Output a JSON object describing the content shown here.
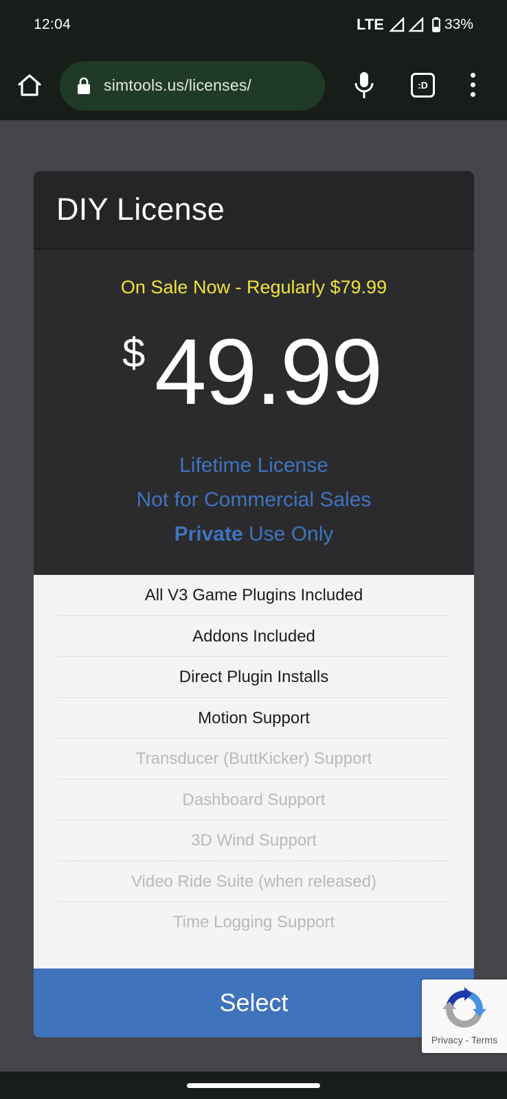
{
  "status_bar": {
    "time": "12:04",
    "network": "LTE",
    "battery": "33%"
  },
  "browser": {
    "url": "simtools.us/licenses/",
    "tab_label": ":D",
    "icons": [
      "home-icon",
      "lock-icon",
      "mic-icon",
      "tab-switcher-icon",
      "more-vert-icon"
    ]
  },
  "license": {
    "title": "DIY License",
    "sale_text": "On Sale Now - Regularly $79.99",
    "currency": "$",
    "price": "49.99",
    "terms": {
      "lifetime": "Lifetime License",
      "commercial": "Not for Commercial Sales",
      "private_bold": "Private",
      "private_rest": " Use Only"
    },
    "features": [
      {
        "label": "All V3 Game Plugins Included",
        "included": true
      },
      {
        "label": "Addons Included",
        "included": true
      },
      {
        "label": "Direct Plugin Installs",
        "included": true
      },
      {
        "label": "Motion Support",
        "included": true
      },
      {
        "label": "Transducer (ButtKicker) Support",
        "included": false
      },
      {
        "label": "Dashboard Support",
        "included": false
      },
      {
        "label": "3D Wind Support",
        "included": false
      },
      {
        "label": "Video Ride Suite (when released)",
        "included": false
      },
      {
        "label": "Time Logging Support",
        "included": false
      }
    ],
    "select_label": "Select"
  },
  "recaptcha": {
    "privacy": "Privacy",
    "separator": " - ",
    "terms": "Terms"
  },
  "colors": {
    "sale": "#efe33a",
    "terms_blue": "#3f74c0",
    "select_button": "#3f73bb",
    "chrome_dark": "#171d18",
    "url_pill": "#1f3b27"
  }
}
